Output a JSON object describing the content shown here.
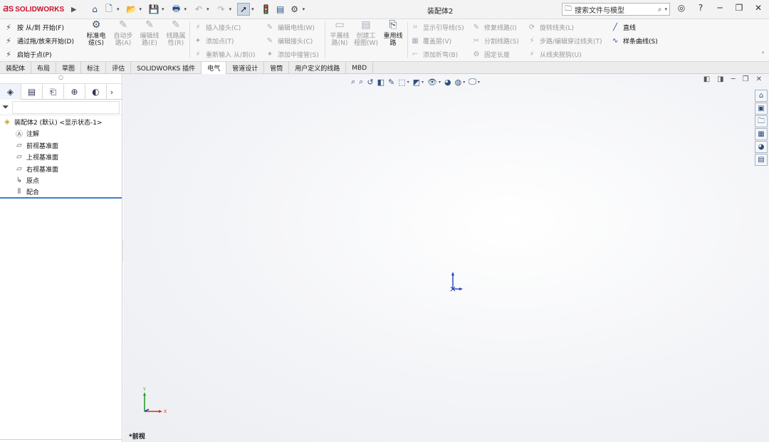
{
  "app": {
    "brand": "SOLIDWORKS",
    "document_title": "装配体2"
  },
  "search": {
    "placeholder": "搜索文件与模型"
  },
  "ribbon": {
    "left_commands": [
      {
        "label": "按 从/到 开始(F)",
        "icon": "route-from-to-icon"
      },
      {
        "label": "通过拖/放来开始(D)",
        "icon": "drag-drop-route-icon"
      },
      {
        "label": "启始于点(P)",
        "icon": "start-at-point-icon"
      }
    ],
    "big_buttons": [
      {
        "label": "标准电缆(S)",
        "icon": "standard-cable-icon",
        "enabled": true
      },
      {
        "label": "自动步路(A)",
        "icon": "auto-route-icon",
        "enabled": false
      },
      {
        "label": "编辑线路(E)",
        "icon": "edit-route-icon",
        "enabled": false
      },
      {
        "label": "线路属性(R)",
        "icon": "route-properties-icon",
        "enabled": false
      }
    ],
    "col1": [
      {
        "label": "插入接头(C)",
        "icon": "insert-connector-icon"
      },
      {
        "label": "添加点(T)",
        "icon": "add-point-icon"
      },
      {
        "label": "重新输入 从/到(I)",
        "icon": "reimport-from-to-icon"
      }
    ],
    "col2": [
      {
        "label": "编辑电线(W)",
        "icon": "edit-wire-icon"
      },
      {
        "label": "编辑接头(C)",
        "icon": "edit-connector-icon"
      },
      {
        "label": "添加中接管(S)",
        "icon": "add-splice-icon"
      }
    ],
    "big_buttons2": [
      {
        "label": "平展线路(N)",
        "icon": "flatten-route-icon",
        "enabled": false
      },
      {
        "label": "创建工程图(W)",
        "icon": "create-drawing-icon",
        "enabled": false
      },
      {
        "label": "重用线路",
        "icon": "reuse-route-icon",
        "enabled": true
      }
    ],
    "col3": [
      {
        "label": "显示引导线(S)",
        "icon": "show-guidelines-icon"
      },
      {
        "label": "覆盖层(V)",
        "icon": "covering-icon"
      },
      {
        "label": "添加折弯(B)",
        "icon": "add-bend-icon"
      }
    ],
    "col4": [
      {
        "label": "修复线路(I)",
        "icon": "repair-route-icon"
      },
      {
        "label": "分割线路(S)",
        "icon": "split-route-icon"
      },
      {
        "label": "固定长度",
        "icon": "fixed-length-icon"
      }
    ],
    "col5": [
      {
        "label": "旋转线夹(L)",
        "icon": "rotate-clip-icon"
      },
      {
        "label": "步路/编辑穿过线夹(T)",
        "icon": "route-through-clip-icon"
      },
      {
        "label": "从线夹脱钩(U)",
        "icon": "unhook-clip-icon"
      }
    ],
    "sketch": [
      {
        "label": "直线",
        "icon": "line-icon"
      },
      {
        "label": "样条曲线(S)",
        "icon": "spline-icon"
      }
    ]
  },
  "tabs": [
    {
      "label": "装配体",
      "active": false
    },
    {
      "label": "布局",
      "active": false
    },
    {
      "label": "草图",
      "active": false
    },
    {
      "label": "标注",
      "active": false
    },
    {
      "label": "评估",
      "active": false
    },
    {
      "label": "SOLIDWORKS 插件",
      "active": false
    },
    {
      "label": "电气",
      "active": true
    },
    {
      "label": "管道设计",
      "active": false
    },
    {
      "label": "管筒",
      "active": false
    },
    {
      "label": "用户定义的线路",
      "active": false
    },
    {
      "label": "MBD",
      "active": false
    }
  ],
  "feature_tree": {
    "root": "装配体2 (默认) <显示状态-1>",
    "items": [
      {
        "label": "注解",
        "icon": "annotations-icon"
      },
      {
        "label": "前视基准面",
        "icon": "plane-icon"
      },
      {
        "label": "上视基准面",
        "icon": "plane-icon"
      },
      {
        "label": "右视基准面",
        "icon": "plane-icon"
      },
      {
        "label": "原点",
        "icon": "origin-icon"
      },
      {
        "label": "配合",
        "icon": "mates-icon"
      }
    ]
  },
  "viewport": {
    "view_name": "*前视",
    "triad_axes": {
      "y": "Y",
      "x": "X"
    }
  }
}
